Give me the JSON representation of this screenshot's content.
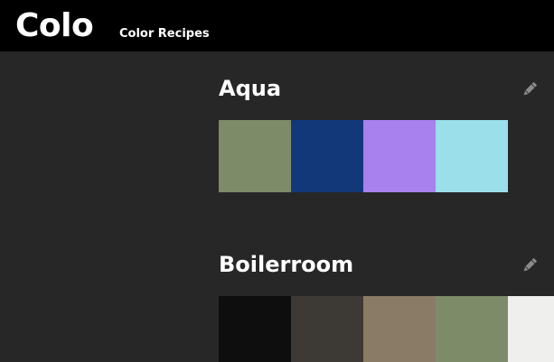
{
  "header": {
    "logo": "Colo",
    "nav_label": "Color Recipes"
  },
  "recipes": [
    {
      "title": "Aqua",
      "colors": [
        "#7e8b69",
        "#133879",
        "#a881ee",
        "#9adfe9"
      ]
    },
    {
      "title": "Boilerroom",
      "colors": [
        "#0d0e0d",
        "#3d3934",
        "#8a7b67",
        "#7e8b69",
        "#eff0ee"
      ]
    }
  ],
  "icons": {
    "edit": "pencil-icon"
  }
}
